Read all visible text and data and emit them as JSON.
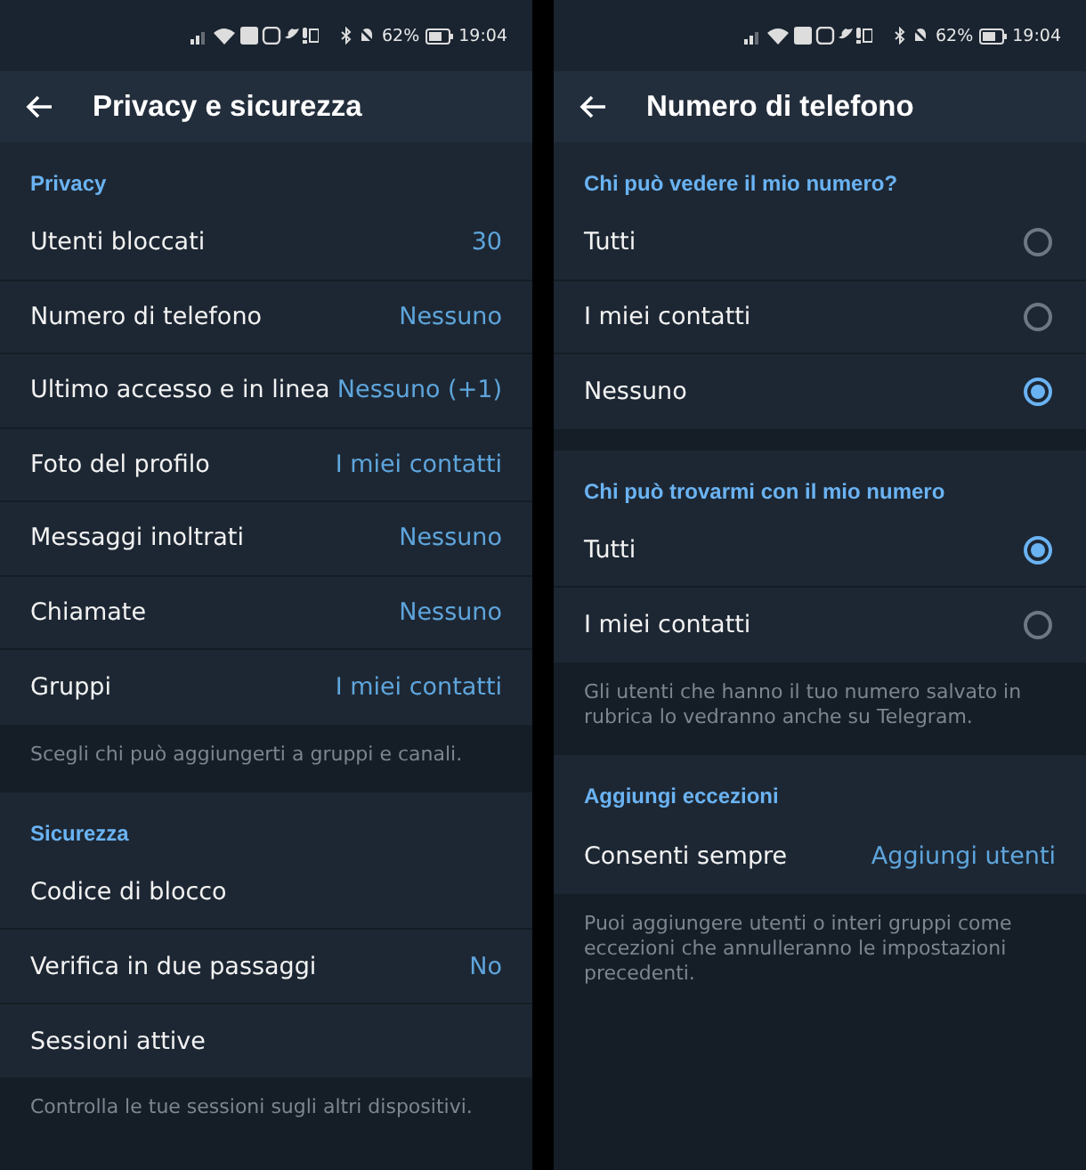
{
  "panels": [
    {
      "status_bar": {
        "battery": "62%",
        "time": "19:04"
      },
      "title": "Privacy e sicurezza",
      "sections": [
        {
          "header": "Privacy",
          "rows": [
            {
              "kind": "value",
              "label": "Utenti bloccati",
              "value": "30"
            },
            {
              "kind": "value",
              "label": "Numero di telefono",
              "value": "Nessuno"
            },
            {
              "kind": "value",
              "label": "Ultimo accesso e in linea",
              "value": "Nessuno (+1)"
            },
            {
              "kind": "value",
              "label": "Foto del profilo",
              "value": "I miei contatti"
            },
            {
              "kind": "value",
              "label": "Messaggi inoltrati",
              "value": "Nessuno"
            },
            {
              "kind": "value",
              "label": "Chiamate",
              "value": "Nessuno"
            },
            {
              "kind": "value",
              "label": "Gruppi",
              "value": "I miei contatti"
            }
          ],
          "footer": "Scegli chi può aggiungerti a gruppi e canali."
        },
        {
          "header": "Sicurezza",
          "rows": [
            {
              "kind": "plain",
              "label": "Codice di blocco"
            },
            {
              "kind": "value",
              "label": "Verifica in due passaggi",
              "value": "No"
            },
            {
              "kind": "plain",
              "label": "Sessioni attive"
            }
          ],
          "footer": "Controlla le tue sessioni sugli altri dispositivi."
        }
      ]
    },
    {
      "status_bar": {
        "battery": "62%",
        "time": "19:04"
      },
      "title": "Numero di telefono",
      "sections": [
        {
          "header": "Chi può vedere il mio numero?",
          "rows": [
            {
              "kind": "radio",
              "label": "Tutti",
              "selected": false
            },
            {
              "kind": "radio",
              "label": "I miei contatti",
              "selected": false
            },
            {
              "kind": "radio",
              "label": "Nessuno",
              "selected": true
            }
          ]
        },
        {
          "header": "Chi può trovarmi con il mio numero",
          "rows": [
            {
              "kind": "radio",
              "label": "Tutti",
              "selected": true
            },
            {
              "kind": "radio",
              "label": "I miei contatti",
              "selected": false
            }
          ],
          "footer": "Gli utenti che hanno il tuo numero salvato in rubrica lo vedranno anche su Telegram."
        },
        {
          "header": "Aggiungi eccezioni",
          "rows": [
            {
              "kind": "value",
              "label": "Consenti sempre",
              "value": "Aggiungi utenti"
            }
          ],
          "footer": "Puoi aggiungere utenti o interi gruppi come eccezioni che annulleranno le impostazioni precedenti."
        }
      ]
    }
  ]
}
